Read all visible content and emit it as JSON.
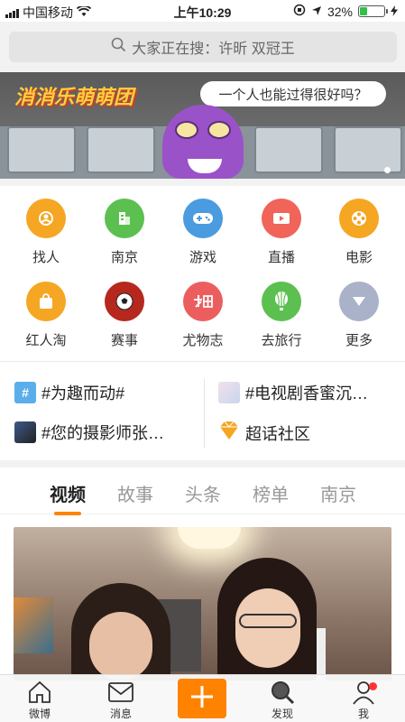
{
  "status_bar": {
    "carrier": "中国移动",
    "time": "上午10:29",
    "battery_percent": "32%",
    "battery_level": 0.32,
    "colors": {
      "battery": "#33c048"
    }
  },
  "search": {
    "placeholder": "大家正在搜：许昕 双冠王"
  },
  "banner": {
    "logo_text": "消消乐萌萌团",
    "bubble_text": "一个人也能过得很好吗？"
  },
  "grid": [
    {
      "label": "找人",
      "icon": "person-icon",
      "color": "#f5a623"
    },
    {
      "label": "南京",
      "icon": "city-icon",
      "color": "#5cc050"
    },
    {
      "label": "游戏",
      "icon": "gamepad-icon",
      "color": "#4a9be0"
    },
    {
      "label": "直播",
      "icon": "video-icon",
      "color": "#f0645a"
    },
    {
      "label": "电影",
      "icon": "film-icon",
      "color": "#f5a623"
    },
    {
      "label": "红人淘",
      "icon": "shopping-bag-icon",
      "color": "#f5a623"
    },
    {
      "label": "赛事",
      "icon": "soccer-icon",
      "color": "#b6281d"
    },
    {
      "label": "尤物志",
      "icon": "youwu-icon",
      "color": "#ec5e5e"
    },
    {
      "label": "去旅行",
      "icon": "balloon-icon",
      "color": "#5cc050"
    },
    {
      "label": "更多",
      "icon": "chevron-down-icon",
      "color": "#a9b2c8"
    }
  ],
  "topics": [
    {
      "text": "#为趣而动#"
    },
    {
      "text": "#电视剧香蜜沉…"
    },
    {
      "text": "#您的摄影师张…"
    },
    {
      "text": "超话社区"
    }
  ],
  "tabs": [
    "视频",
    "故事",
    "头条",
    "榜单",
    "南京"
  ],
  "active_tab": "视频",
  "bottom_nav": [
    {
      "label": "微博",
      "icon": "home-icon"
    },
    {
      "label": "消息",
      "icon": "message-icon"
    },
    {
      "label": "",
      "icon": "plus-icon"
    },
    {
      "label": "发现",
      "icon": "discover-icon"
    },
    {
      "label": "我",
      "icon": "profile-icon"
    }
  ],
  "colors": {
    "accent": "#ff8200"
  }
}
